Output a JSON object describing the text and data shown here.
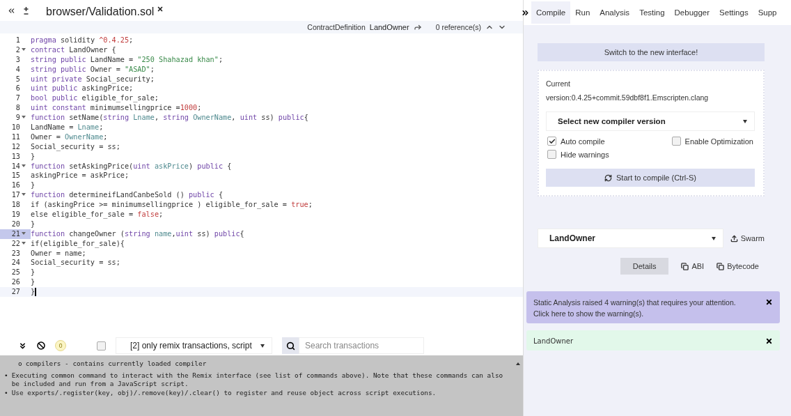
{
  "editor": {
    "tab": {
      "label": "browser/Validation.sol",
      "selected": true
    },
    "breadcrumb": {
      "kind_label": "ContractDefinition",
      "name": "LandOwner",
      "references": "0 reference(s)"
    },
    "lines": [
      {
        "number": "1",
        "fold": false,
        "selected": false,
        "cursor": false,
        "tokens": [
          {
            "kind": "kw",
            "text": "pragma"
          },
          {
            "kind": "plain",
            "text": " solidity "
          },
          {
            "kind": "num",
            "text": "^0.4.25"
          },
          {
            "kind": "plain",
            "text": ";"
          }
        ]
      },
      {
        "number": "2",
        "fold": true,
        "selected": false,
        "cursor": false,
        "tokens": [
          {
            "kind": "kw",
            "text": "contract"
          },
          {
            "kind": "plain",
            "text": " LandOwner {"
          }
        ]
      },
      {
        "number": "3",
        "fold": false,
        "selected": false,
        "cursor": false,
        "tokens": [
          {
            "kind": "kw",
            "text": "string public"
          },
          {
            "kind": "plain",
            "text": " LandName = "
          },
          {
            "kind": "str",
            "text": "\"250 Shahazad khan\""
          },
          {
            "kind": "plain",
            "text": ";"
          }
        ]
      },
      {
        "number": "4",
        "fold": false,
        "selected": false,
        "cursor": false,
        "tokens": [
          {
            "kind": "kw",
            "text": "string public"
          },
          {
            "kind": "plain",
            "text": " Owner = "
          },
          {
            "kind": "str",
            "text": "\"ASAD\""
          },
          {
            "kind": "plain",
            "text": ";"
          }
        ]
      },
      {
        "number": "5",
        "fold": false,
        "selected": false,
        "cursor": false,
        "tokens": [
          {
            "kind": "kw",
            "text": "uint private"
          },
          {
            "kind": "plain",
            "text": " Social_security;"
          }
        ]
      },
      {
        "number": "6",
        "fold": false,
        "selected": false,
        "cursor": false,
        "tokens": [
          {
            "kind": "kw",
            "text": "uint public"
          },
          {
            "kind": "plain",
            "text": " askingPrice;"
          }
        ]
      },
      {
        "number": "7",
        "fold": false,
        "selected": false,
        "cursor": false,
        "tokens": [
          {
            "kind": "kw",
            "text": "bool public"
          },
          {
            "kind": "plain",
            "text": " eligible_for_sale;"
          }
        ]
      },
      {
        "number": "8",
        "fold": false,
        "selected": false,
        "cursor": false,
        "tokens": [
          {
            "kind": "kw",
            "text": "uint constant"
          },
          {
            "kind": "plain",
            "text": " minimumsellingprice ="
          },
          {
            "kind": "num",
            "text": "1000"
          },
          {
            "kind": "plain",
            "text": ";"
          }
        ]
      },
      {
        "number": "9",
        "fold": true,
        "selected": false,
        "cursor": false,
        "tokens": [
          {
            "kind": "kw",
            "text": "function"
          },
          {
            "kind": "plain",
            "text": " setName("
          },
          {
            "kind": "kw",
            "text": "string"
          },
          {
            "kind": "param",
            "text": " Lname"
          },
          {
            "kind": "plain",
            "text": ", "
          },
          {
            "kind": "kw",
            "text": "string"
          },
          {
            "kind": "param",
            "text": " OwnerName"
          },
          {
            "kind": "plain",
            "text": ", "
          },
          {
            "kind": "kw",
            "text": "uint"
          },
          {
            "kind": "plain",
            "text": " ss) "
          },
          {
            "kind": "kw",
            "text": "public"
          },
          {
            "kind": "plain",
            "text": "{"
          }
        ]
      },
      {
        "number": "10",
        "fold": false,
        "selected": false,
        "cursor": false,
        "tokens": [
          {
            "kind": "plain",
            "text": "LandName = "
          },
          {
            "kind": "param",
            "text": "Lname"
          },
          {
            "kind": "plain",
            "text": ";"
          }
        ]
      },
      {
        "number": "11",
        "fold": false,
        "selected": false,
        "cursor": false,
        "tokens": [
          {
            "kind": "plain",
            "text": "Owner = "
          },
          {
            "kind": "param",
            "text": "OwnerName"
          },
          {
            "kind": "plain",
            "text": ";"
          }
        ]
      },
      {
        "number": "12",
        "fold": false,
        "selected": false,
        "cursor": false,
        "tokens": [
          {
            "kind": "plain",
            "text": "Social_security = ss;"
          }
        ]
      },
      {
        "number": "13",
        "fold": false,
        "selected": false,
        "cursor": false,
        "tokens": [
          {
            "kind": "plain",
            "text": "}"
          }
        ]
      },
      {
        "number": "14",
        "fold": true,
        "selected": false,
        "cursor": false,
        "tokens": [
          {
            "kind": "kw",
            "text": "function"
          },
          {
            "kind": "plain",
            "text": " setAskingPrice("
          },
          {
            "kind": "kw",
            "text": "uint"
          },
          {
            "kind": "param",
            "text": " askPrice"
          },
          {
            "kind": "plain",
            "text": ") "
          },
          {
            "kind": "kw",
            "text": "public"
          },
          {
            "kind": "plain",
            "text": " {"
          }
        ]
      },
      {
        "number": "15",
        "fold": false,
        "selected": false,
        "cursor": false,
        "tokens": [
          {
            "kind": "plain",
            "text": "askingPrice = askPrice;"
          }
        ]
      },
      {
        "number": "16",
        "fold": false,
        "selected": false,
        "cursor": false,
        "tokens": [
          {
            "kind": "plain",
            "text": "}"
          }
        ]
      },
      {
        "number": "17",
        "fold": true,
        "selected": false,
        "cursor": false,
        "tokens": [
          {
            "kind": "kw",
            "text": "function"
          },
          {
            "kind": "plain",
            "text": " determineifLandCanbeSold () "
          },
          {
            "kind": "kw",
            "text": "public"
          },
          {
            "kind": "plain",
            "text": " {"
          }
        ]
      },
      {
        "number": "18",
        "fold": false,
        "selected": false,
        "cursor": false,
        "tokens": [
          {
            "kind": "plain",
            "text": "if (askingPrice >= minimumsellingprice ) eligible_for_sale = "
          },
          {
            "kind": "num",
            "text": "true"
          },
          {
            "kind": "plain",
            "text": ";"
          }
        ]
      },
      {
        "number": "19",
        "fold": false,
        "selected": false,
        "cursor": false,
        "tokens": [
          {
            "kind": "plain",
            "text": "else eligible_for_sale = "
          },
          {
            "kind": "num",
            "text": "false"
          },
          {
            "kind": "plain",
            "text": ";"
          }
        ]
      },
      {
        "number": "20",
        "fold": false,
        "selected": false,
        "cursor": false,
        "tokens": [
          {
            "kind": "plain",
            "text": "}"
          }
        ]
      },
      {
        "number": "21",
        "fold": true,
        "selected": true,
        "cursor": false,
        "tokens": [
          {
            "kind": "kw",
            "text": "function"
          },
          {
            "kind": "plain",
            "text": " changeOwner ("
          },
          {
            "kind": "kw",
            "text": "string"
          },
          {
            "kind": "param",
            "text": " name"
          },
          {
            "kind": "plain",
            "text": ","
          },
          {
            "kind": "kw",
            "text": "uint"
          },
          {
            "kind": "plain",
            "text": " ss) "
          },
          {
            "kind": "kw",
            "text": "public"
          },
          {
            "kind": "plain",
            "text": "{"
          }
        ]
      },
      {
        "number": "22",
        "fold": true,
        "selected": false,
        "cursor": false,
        "tokens": [
          {
            "kind": "plain",
            "text": "if(eligible_for_sale){"
          }
        ]
      },
      {
        "number": "23",
        "fold": false,
        "selected": false,
        "cursor": false,
        "tokens": [
          {
            "kind": "plain",
            "text": "Owner = name;"
          }
        ]
      },
      {
        "number": "24",
        "fold": false,
        "selected": false,
        "cursor": false,
        "tokens": [
          {
            "kind": "plain",
            "text": "Social_security = ss;"
          }
        ]
      },
      {
        "number": "25",
        "fold": false,
        "selected": false,
        "cursor": false,
        "tokens": [
          {
            "kind": "plain",
            "text": "}"
          }
        ]
      },
      {
        "number": "26",
        "fold": false,
        "selected": false,
        "cursor": false,
        "tokens": [
          {
            "kind": "plain",
            "text": "}"
          }
        ]
      },
      {
        "number": "27",
        "fold": false,
        "selected": false,
        "cursor": true,
        "tokens": [
          {
            "kind": "plain",
            "text": "}"
          }
        ]
      }
    ]
  },
  "terminal": {
    "toolbar": {
      "pending_count": "0",
      "listen_checked": false,
      "filter": "[2] only remix transactions, script",
      "search_placeholder": "Search transactions"
    },
    "lines": [
      {
        "kind": "sub",
        "marker": "o",
        "text": "compilers - contains currently loaded compiler"
      },
      {
        "kind": "main",
        "marker": "•",
        "text": "Executing common command to interact with the Remix interface (see list of commands above). Note that these commands can also be included and run from a JavaScript script."
      },
      {
        "kind": "main",
        "marker": "•",
        "text": "Use exports/.register(key, obj)/.remove(key)/.clear() to register and reuse object across script executions."
      }
    ]
  },
  "side_panel": {
    "tabs": [
      {
        "label": "Compile",
        "selected": true
      },
      {
        "label": "Run",
        "selected": false
      },
      {
        "label": "Analysis",
        "selected": false
      },
      {
        "label": "Testing",
        "selected": false
      },
      {
        "label": "Debugger",
        "selected": false
      },
      {
        "label": "Settings",
        "selected": false
      },
      {
        "label": "Supp",
        "selected": false
      }
    ],
    "switch_button": "Switch to the new interface!",
    "compiler": {
      "current_label": "Current",
      "version": "version:0.4.25+commit.59dbf8f1.Emscripten.clang",
      "select": "Select new compiler version",
      "checkboxes": [
        {
          "label": "Auto compile",
          "checked": true
        },
        {
          "label": "Enable Optimization",
          "checked": false
        },
        {
          "label": "Hide warnings",
          "checked": false
        }
      ],
      "compile_button": "Start to compile (Ctrl-S)"
    },
    "contract": {
      "select": "LandOwner",
      "swarm": "Swarm",
      "details": "Details",
      "abi": "ABI",
      "bytecode": "Bytecode"
    },
    "alerts": [
      {
        "kind": "warning",
        "lines": [
          "Static Analysis raised 4 warning(s) that requires your attention.",
          "Click here to show the warning(s)."
        ]
      },
      {
        "kind": "success",
        "lines": [
          "LandOwner"
        ]
      }
    ]
  }
}
